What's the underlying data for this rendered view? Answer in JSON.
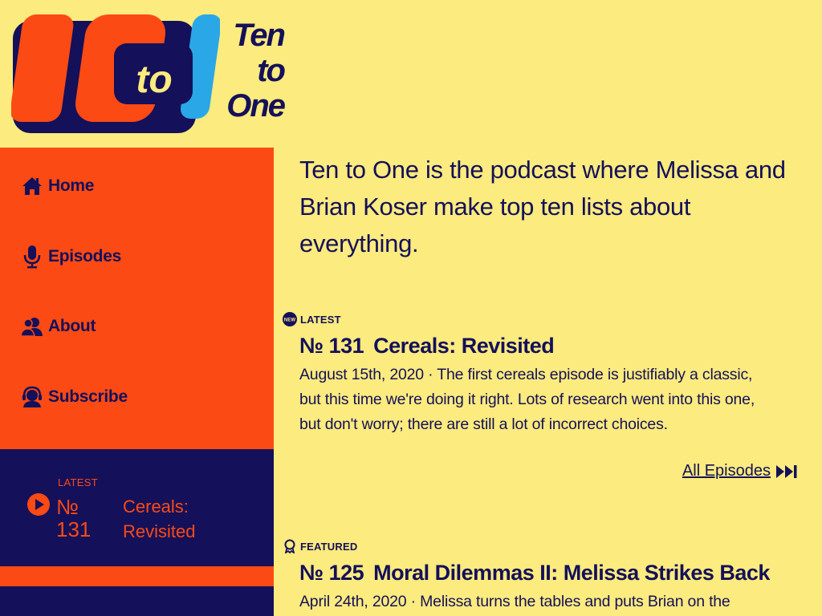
{
  "logo": {
    "mark_text": "to",
    "wordmark": [
      "Ten",
      "to",
      "One"
    ]
  },
  "nav": {
    "items": [
      {
        "label": "Home",
        "icon": "home-icon"
      },
      {
        "label": "Episodes",
        "icon": "microphone-icon"
      },
      {
        "label": "About",
        "icon": "people-icon"
      },
      {
        "label": "Subscribe",
        "icon": "headphones-icon"
      }
    ]
  },
  "sidebar_latest": {
    "tag": "LATEST",
    "number": "№ 131",
    "title": "Cereals: Revisited"
  },
  "intro": "Ten to One is the podcast where Melissa and Brian Koser make top ten lists about everything.",
  "latest": {
    "eyebrow": "LATEST",
    "badge_text": "NEW",
    "number": "№ 131",
    "title": "Cereals: Revisited",
    "description": "August 15th, 2020 · The first cereals episode is justifiably a classic, but this time we're doing it right. Lots of research went into this one, but don't worry; there are still a lot of incorrect choices."
  },
  "all_episodes_label": "All Episodes",
  "featured": {
    "eyebrow": "FEATURED",
    "number": "№ 125",
    "title": "Moral Dilemmas II: Melissa Strikes Back",
    "description": "April 24th, 2020 · Melissa turns the tables and puts Brian on the"
  },
  "colors": {
    "background": "#fceb7e",
    "orange": "#fc4a14",
    "navy": "#14105a",
    "blue": "#2aa7e6"
  }
}
